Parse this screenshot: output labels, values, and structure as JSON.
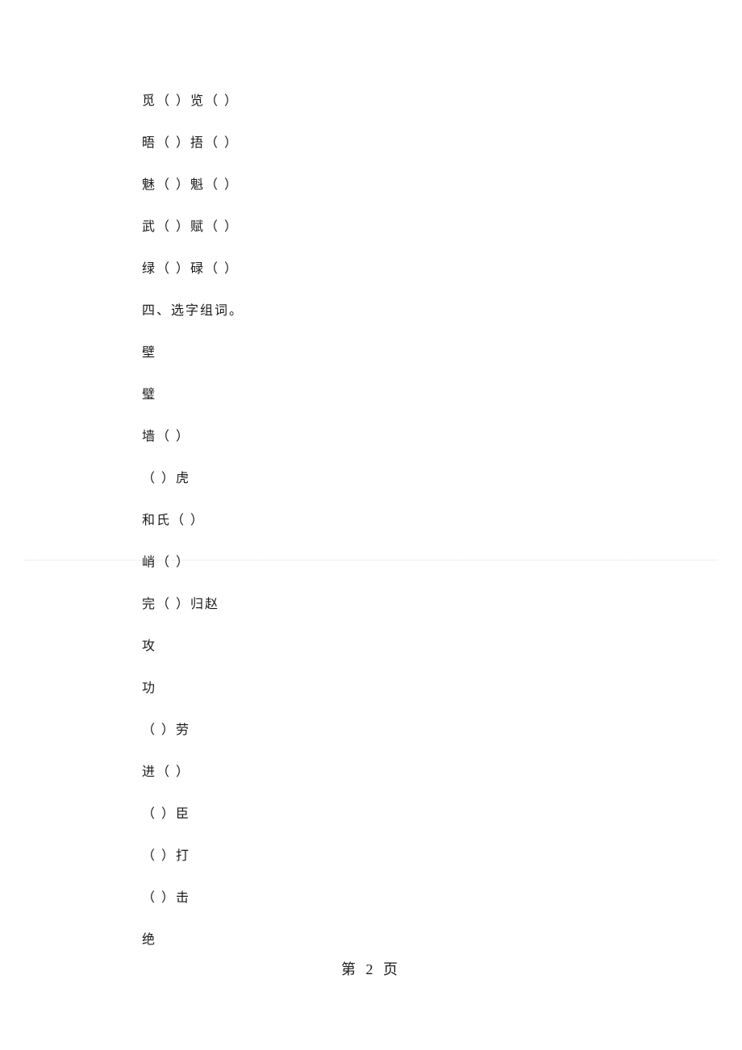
{
  "lines": [
    "觅（ ）览（ ）",
    "晤（ ）捂（ ）",
    "魅（ ）魁（ ）",
    "武（ ）赋（ ）",
    "绿（ ）碌（ ）",
    "四、选字组词。",
    "壁",
    "璧",
    "墙（ ）",
    "（ ）虎",
    "和氏（ ）",
    "峭（ ）",
    "完（ ）归赵",
    "攻",
    "功",
    "（ ）劳",
    "进（ ）",
    "（ ）臣",
    "（ ）打",
    "（ ）击",
    "绝"
  ],
  "page_number": "第 2 页"
}
